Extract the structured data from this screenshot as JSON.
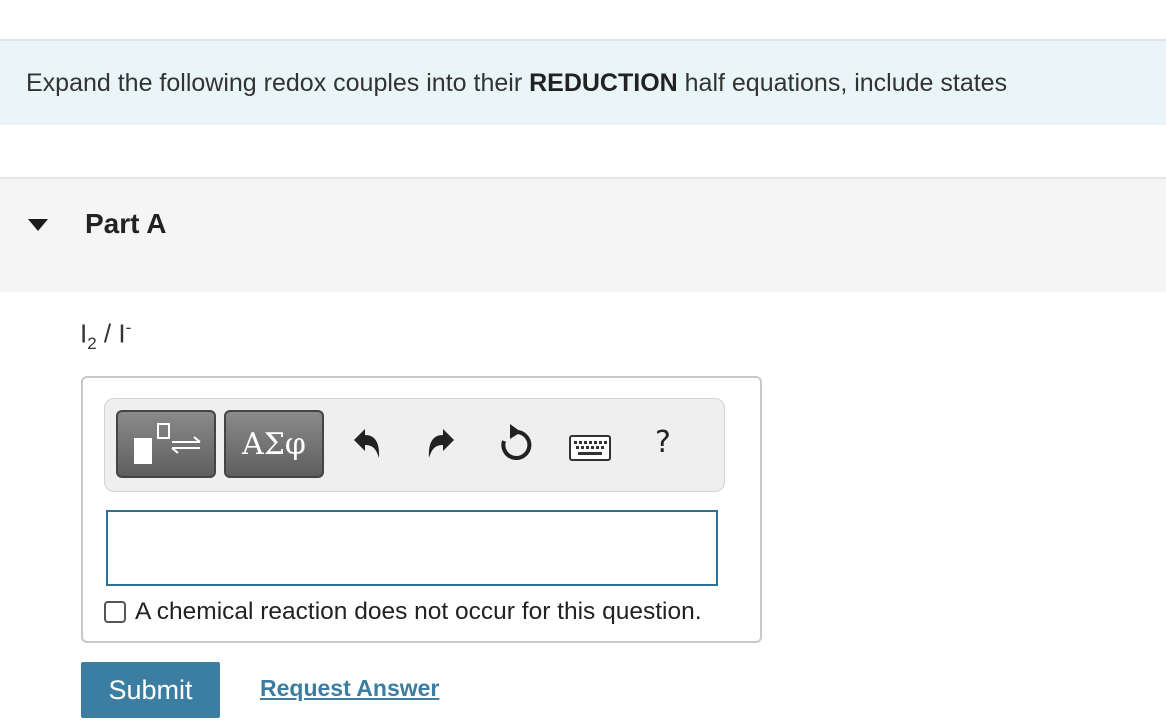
{
  "instructions": {
    "prefix": "Expand the following redox couples into their ",
    "emphasis": "REDUCTION",
    "suffix": " half equations, include states"
  },
  "part": {
    "title": "Part A",
    "couple": {
      "left": "I",
      "left_subscript": "2",
      "separator": " / ",
      "right": "I",
      "right_superscript": "-"
    }
  },
  "toolbar": {
    "templates_icon": "templates-reaction-icon",
    "symbols_label": "ΑΣφ",
    "undo_icon": "undo-icon",
    "redo_icon": "redo-icon",
    "reset_icon": "reset-icon",
    "keyboard_icon": "keyboard-icon",
    "help_label": "?"
  },
  "answer": {
    "value": "",
    "no_reaction_label": "A chemical reaction does not occur for this question.",
    "no_reaction_checked": false
  },
  "actions": {
    "submit_label": "Submit",
    "request_answer_label": "Request Answer"
  },
  "colors": {
    "instructions_bg": "#e9f5f7",
    "part_header_bg": "#f5f5f5",
    "accent": "#3b7ea1",
    "input_border": "#2e7293"
  }
}
